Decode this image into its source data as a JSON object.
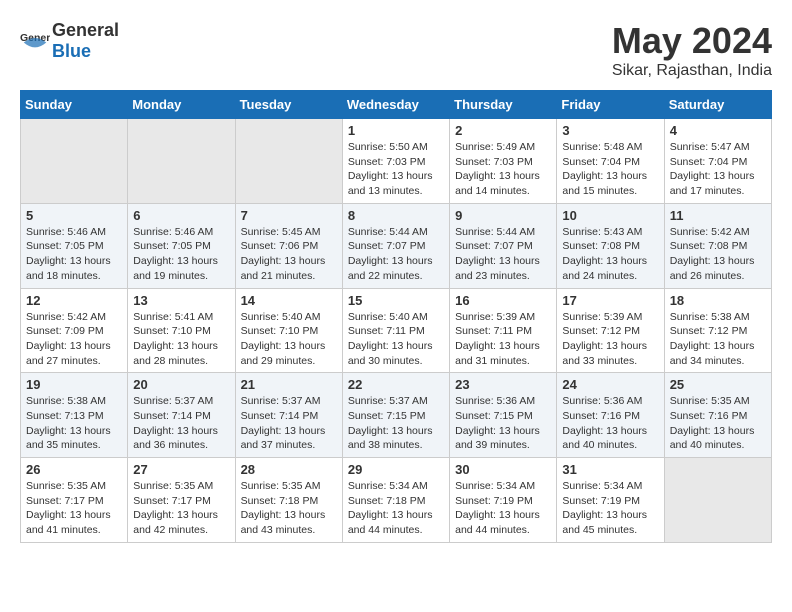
{
  "header": {
    "logo_general": "General",
    "logo_blue": "Blue",
    "month": "May 2024",
    "location": "Sikar, Rajasthan, India"
  },
  "weekdays": [
    "Sunday",
    "Monday",
    "Tuesday",
    "Wednesday",
    "Thursday",
    "Friday",
    "Saturday"
  ],
  "weeks": [
    [
      {
        "day": "",
        "sunrise": "",
        "sunset": "",
        "daylight": ""
      },
      {
        "day": "",
        "sunrise": "",
        "sunset": "",
        "daylight": ""
      },
      {
        "day": "",
        "sunrise": "",
        "sunset": "",
        "daylight": ""
      },
      {
        "day": "1",
        "sunrise": "Sunrise: 5:50 AM",
        "sunset": "Sunset: 7:03 PM",
        "daylight": "Daylight: 13 hours and 13 minutes."
      },
      {
        "day": "2",
        "sunrise": "Sunrise: 5:49 AM",
        "sunset": "Sunset: 7:03 PM",
        "daylight": "Daylight: 13 hours and 14 minutes."
      },
      {
        "day": "3",
        "sunrise": "Sunrise: 5:48 AM",
        "sunset": "Sunset: 7:04 PM",
        "daylight": "Daylight: 13 hours and 15 minutes."
      },
      {
        "day": "4",
        "sunrise": "Sunrise: 5:47 AM",
        "sunset": "Sunset: 7:04 PM",
        "daylight": "Daylight: 13 hours and 17 minutes."
      }
    ],
    [
      {
        "day": "5",
        "sunrise": "Sunrise: 5:46 AM",
        "sunset": "Sunset: 7:05 PM",
        "daylight": "Daylight: 13 hours and 18 minutes."
      },
      {
        "day": "6",
        "sunrise": "Sunrise: 5:46 AM",
        "sunset": "Sunset: 7:05 PM",
        "daylight": "Daylight: 13 hours and 19 minutes."
      },
      {
        "day": "7",
        "sunrise": "Sunrise: 5:45 AM",
        "sunset": "Sunset: 7:06 PM",
        "daylight": "Daylight: 13 hours and 21 minutes."
      },
      {
        "day": "8",
        "sunrise": "Sunrise: 5:44 AM",
        "sunset": "Sunset: 7:07 PM",
        "daylight": "Daylight: 13 hours and 22 minutes."
      },
      {
        "day": "9",
        "sunrise": "Sunrise: 5:44 AM",
        "sunset": "Sunset: 7:07 PM",
        "daylight": "Daylight: 13 hours and 23 minutes."
      },
      {
        "day": "10",
        "sunrise": "Sunrise: 5:43 AM",
        "sunset": "Sunset: 7:08 PM",
        "daylight": "Daylight: 13 hours and 24 minutes."
      },
      {
        "day": "11",
        "sunrise": "Sunrise: 5:42 AM",
        "sunset": "Sunset: 7:08 PM",
        "daylight": "Daylight: 13 hours and 26 minutes."
      }
    ],
    [
      {
        "day": "12",
        "sunrise": "Sunrise: 5:42 AM",
        "sunset": "Sunset: 7:09 PM",
        "daylight": "Daylight: 13 hours and 27 minutes."
      },
      {
        "day": "13",
        "sunrise": "Sunrise: 5:41 AM",
        "sunset": "Sunset: 7:10 PM",
        "daylight": "Daylight: 13 hours and 28 minutes."
      },
      {
        "day": "14",
        "sunrise": "Sunrise: 5:40 AM",
        "sunset": "Sunset: 7:10 PM",
        "daylight": "Daylight: 13 hours and 29 minutes."
      },
      {
        "day": "15",
        "sunrise": "Sunrise: 5:40 AM",
        "sunset": "Sunset: 7:11 PM",
        "daylight": "Daylight: 13 hours and 30 minutes."
      },
      {
        "day": "16",
        "sunrise": "Sunrise: 5:39 AM",
        "sunset": "Sunset: 7:11 PM",
        "daylight": "Daylight: 13 hours and 31 minutes."
      },
      {
        "day": "17",
        "sunrise": "Sunrise: 5:39 AM",
        "sunset": "Sunset: 7:12 PM",
        "daylight": "Daylight: 13 hours and 33 minutes."
      },
      {
        "day": "18",
        "sunrise": "Sunrise: 5:38 AM",
        "sunset": "Sunset: 7:12 PM",
        "daylight": "Daylight: 13 hours and 34 minutes."
      }
    ],
    [
      {
        "day": "19",
        "sunrise": "Sunrise: 5:38 AM",
        "sunset": "Sunset: 7:13 PM",
        "daylight": "Daylight: 13 hours and 35 minutes."
      },
      {
        "day": "20",
        "sunrise": "Sunrise: 5:37 AM",
        "sunset": "Sunset: 7:14 PM",
        "daylight": "Daylight: 13 hours and 36 minutes."
      },
      {
        "day": "21",
        "sunrise": "Sunrise: 5:37 AM",
        "sunset": "Sunset: 7:14 PM",
        "daylight": "Daylight: 13 hours and 37 minutes."
      },
      {
        "day": "22",
        "sunrise": "Sunrise: 5:37 AM",
        "sunset": "Sunset: 7:15 PM",
        "daylight": "Daylight: 13 hours and 38 minutes."
      },
      {
        "day": "23",
        "sunrise": "Sunrise: 5:36 AM",
        "sunset": "Sunset: 7:15 PM",
        "daylight": "Daylight: 13 hours and 39 minutes."
      },
      {
        "day": "24",
        "sunrise": "Sunrise: 5:36 AM",
        "sunset": "Sunset: 7:16 PM",
        "daylight": "Daylight: 13 hours and 40 minutes."
      },
      {
        "day": "25",
        "sunrise": "Sunrise: 5:35 AM",
        "sunset": "Sunset: 7:16 PM",
        "daylight": "Daylight: 13 hours and 40 minutes."
      }
    ],
    [
      {
        "day": "26",
        "sunrise": "Sunrise: 5:35 AM",
        "sunset": "Sunset: 7:17 PM",
        "daylight": "Daylight: 13 hours and 41 minutes."
      },
      {
        "day": "27",
        "sunrise": "Sunrise: 5:35 AM",
        "sunset": "Sunset: 7:17 PM",
        "daylight": "Daylight: 13 hours and 42 minutes."
      },
      {
        "day": "28",
        "sunrise": "Sunrise: 5:35 AM",
        "sunset": "Sunset: 7:18 PM",
        "daylight": "Daylight: 13 hours and 43 minutes."
      },
      {
        "day": "29",
        "sunrise": "Sunrise: 5:34 AM",
        "sunset": "Sunset: 7:18 PM",
        "daylight": "Daylight: 13 hours and 44 minutes."
      },
      {
        "day": "30",
        "sunrise": "Sunrise: 5:34 AM",
        "sunset": "Sunset: 7:19 PM",
        "daylight": "Daylight: 13 hours and 44 minutes."
      },
      {
        "day": "31",
        "sunrise": "Sunrise: 5:34 AM",
        "sunset": "Sunset: 7:19 PM",
        "daylight": "Daylight: 13 hours and 45 minutes."
      },
      {
        "day": "",
        "sunrise": "",
        "sunset": "",
        "daylight": ""
      }
    ]
  ]
}
